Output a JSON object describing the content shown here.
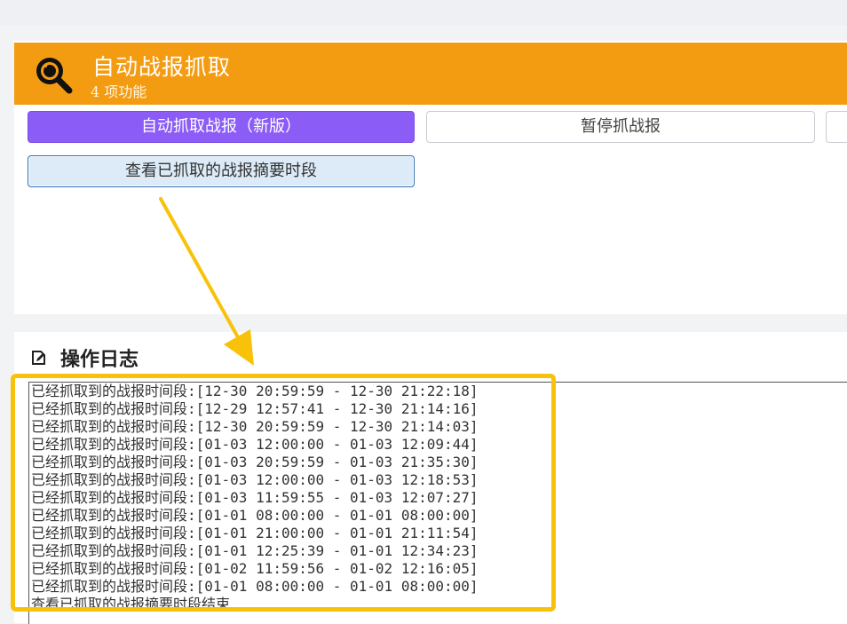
{
  "header": {
    "title": "自动战报抓取",
    "subtitle": "4 项功能",
    "icon": "search-icon",
    "color": "#f39c12"
  },
  "buttons": {
    "auto_fetch": "自动抓取战报（新版）",
    "pause_fetch": "暂停抓战报",
    "view_periods": "查看已抓取的战报摘要时段"
  },
  "log": {
    "title": "操作日志",
    "icon": "edit-icon",
    "lines": [
      "已经抓取到的战报时间段:[12-30 20:59:59 - 12-30 21:22:18]",
      "已经抓取到的战报时间段:[12-29 12:57:41 - 12-30 21:14:16]",
      "已经抓取到的战报时间段:[12-30 20:59:59 - 12-30 21:14:03]",
      "已经抓取到的战报时间段:[01-03 12:00:00 - 01-03 12:09:44]",
      "已经抓取到的战报时间段:[01-03 20:59:59 - 01-03 21:35:30]",
      "已经抓取到的战报时间段:[01-03 12:00:00 - 01-03 12:18:53]",
      "已经抓取到的战报时间段:[01-03 11:59:55 - 01-03 12:07:27]",
      "已经抓取到的战报时间段:[01-01 08:00:00 - 01-01 08:00:00]",
      "已经抓取到的战报时间段:[01-01 21:00:00 - 01-01 21:11:54]",
      "已经抓取到的战报时间段:[01-01 12:25:39 - 01-01 12:34:23]",
      "已经抓取到的战报时间段:[01-02 11:59:56 - 01-02 12:16:05]",
      "已经抓取到的战报时间段:[01-01 08:00:00 - 01-01 08:00:00]",
      "查看已抓取的战报摘要时段结束"
    ]
  },
  "annotation": {
    "color": "#f8c20a"
  }
}
